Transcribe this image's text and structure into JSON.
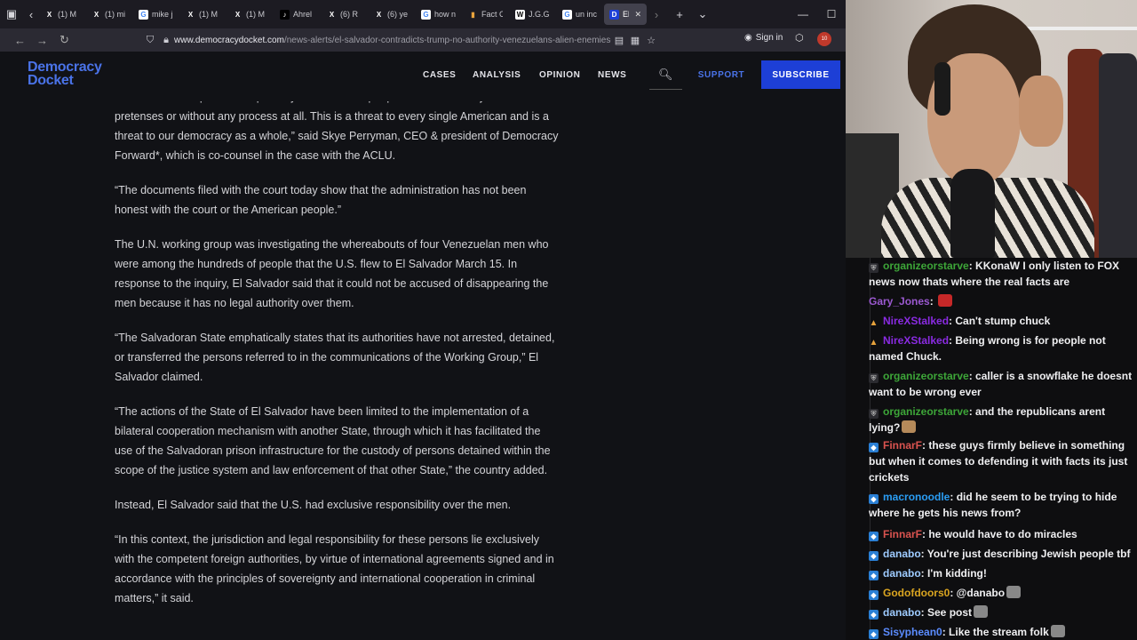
{
  "tabs": [
    {
      "label": "(1) M",
      "favicon": "x-icon",
      "color": "#000000"
    },
    {
      "label": "(1) mi",
      "favicon": "x-icon",
      "color": "#000000"
    },
    {
      "label": "mike j",
      "favicon": "google-icon",
      "color": "#ffffff"
    },
    {
      "label": "(1) M",
      "favicon": "x-icon",
      "color": "#000000"
    },
    {
      "label": "(1) M",
      "favicon": "x-icon",
      "color": "#000000"
    },
    {
      "label": "Ahrel",
      "favicon": "tiktok-icon",
      "color": "#000000"
    },
    {
      "label": "(6) R",
      "favicon": "x-icon",
      "color": "#000000"
    },
    {
      "label": "(6) ye",
      "favicon": "x-icon",
      "color": "#000000"
    },
    {
      "label": "how n",
      "favicon": "google-icon",
      "color": "#ffffff"
    },
    {
      "label": "Fact C",
      "favicon": "bookmark-icon",
      "color": "#e8a33c"
    },
    {
      "label": "J.G.G.",
      "favicon": "wikipedia-icon",
      "color": "#ffffff"
    },
    {
      "label": "un inc",
      "favicon": "google-icon",
      "color": "#ffffff"
    },
    {
      "label": "El S",
      "favicon": "democracy-docket-icon",
      "color": "#1d3fd6",
      "active": true
    }
  ],
  "address_bar": {
    "domain": "www.democracydocket.com",
    "path": "/news-alerts/el-salvador-contradicts-trump-no-authority-venezuelans-alien-enemies-ac"
  },
  "toolbar": {
    "sign_in": "Sign in",
    "ext_badge": "10"
  },
  "site": {
    "logo_line1": "Democracy",
    "logo_line2": "Docket",
    "nav": [
      "CASES",
      "ANALYSIS",
      "OPINION",
      "NEWS"
    ],
    "support": "SUPPORT",
    "subscribe": "SUBSCRIBE",
    "accent": "#4a73e8",
    "subscribe_bg": "#1d3fd6"
  },
  "article": {
    "paragraphs": [
      "shadows without public transparency as it removes people from the country under false pretenses or without any process at all. This is a threat to every single American and is a threat to our democracy as a whole,” said Skye Perryman, CEO & president of Democracy Forward*, which is co-counsel in the case with the ACLU.",
      "“The documents filed with the court today show that the administration has not been honest with the court or the American people.”",
      "The U.N. working group was investigating the whereabouts of four Venezuelan men who were among the hundreds of people that the U.S. flew to El Salvador March 15. In response to the inquiry, El Salvador said that it could not be accused of disappearing the men because it has no legal authority over them.",
      "“The Salvadoran State emphatically states that its authorities have not arrested, detained, or transferred the persons referred to in the communications of the Working Group,” El Salvador claimed.",
      "“The actions of the State of El Salvador have been limited to the implementation of a bilateral cooperation mechanism with another State, through which it has facilitated the use of the Salvadoran prison infrastructure for the custody of persons detained within the scope of the justice system and law enforcement of that other State,” the country added.",
      "Instead, El Salvador said that the U.S. had exclusive responsibility over the men.",
      "“In this context, the jurisdiction and legal responsibility for these persons lie exclusively with the competent foreign authorities, by virtue of international agreements signed and in accordance with the principles of sovereignty and international cooperation in criminal matters,” it said."
    ]
  },
  "chat": {
    "messages": [
      {
        "badge": "mod",
        "user": "organizeorstarve",
        "color": "#3da638",
        "text": ": KKonaW I only listen to FOX news now thats where the real facts are",
        "emote": false
      },
      {
        "badge": "none",
        "user": "Gary_Jones",
        "color": "#9b59d0",
        "text": ": ",
        "emote": true,
        "emote_color": "#c62828"
      },
      {
        "badge": "vip",
        "user": "NireXStalked",
        "color": "#8a2be2",
        "text": ": Can't stump chuck",
        "emote": false
      },
      {
        "badge": "vip",
        "user": "NireXStalked",
        "color": "#8a2be2",
        "text": ": Being wrong is for people not named Chuck.",
        "emote": false
      },
      {
        "badge": "mod",
        "user": "organizeorstarve",
        "color": "#3da638",
        "text": ": caller is a snowflake he doesnt want to be wrong ever",
        "emote": false
      },
      {
        "badge": "mod",
        "user": "organizeorstarve",
        "color": "#3da638",
        "text": ": and the republicans arent lying?",
        "emote": true,
        "emote_color": "#b58a5a"
      },
      {
        "badge": "sub",
        "user": "FinnarF",
        "color": "#d9534f",
        "text": ": these guys firmly believe in something but when it comes to defending it with facts its just crickets",
        "emote": false
      },
      {
        "badge": "sub",
        "user": "macronoodle",
        "color": "#2a9df4",
        "text": ": did he seem to be trying to hide where he gets his news from?",
        "emote": false
      },
      {
        "badge": "sub",
        "user": "FinnarF",
        "color": "#d9534f",
        "text": ": he would have to do miracles",
        "emote": false
      },
      {
        "badge": "sub",
        "user": "danabo",
        "color": "#9ecbff",
        "text": ": You're just describing Jewish people tbf",
        "emote": false
      },
      {
        "badge": "sub",
        "user": "danabo",
        "color": "#9ecbff",
        "text": ": I'm kidding!",
        "emote": false
      },
      {
        "badge": "sub",
        "user": "Godofdoors0",
        "color": "#daa520",
        "text": ": @danabo",
        "emote": true,
        "emote_color": "#888888"
      },
      {
        "badge": "sub",
        "user": "danabo",
        "color": "#9ecbff",
        "text": ": See   post",
        "emote": true,
        "emote_color": "#888888"
      },
      {
        "badge": "sub",
        "user": "Sisyphean0",
        "color": "#5b8cff",
        "text": ": Like the stream folk",
        "emote": true,
        "emote_color": "#888888"
      }
    ]
  }
}
